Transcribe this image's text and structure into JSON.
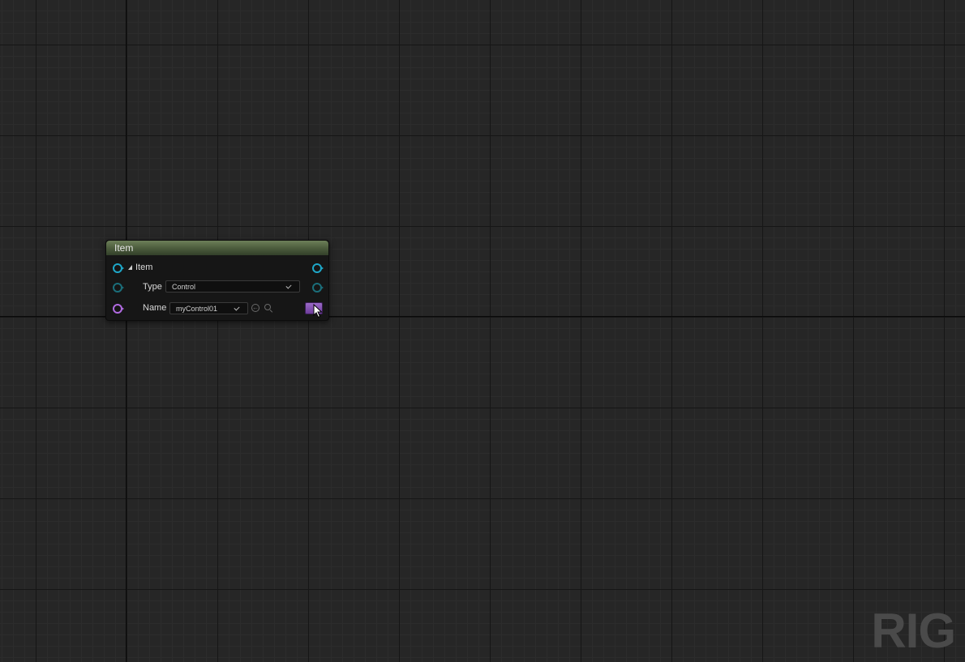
{
  "node": {
    "title": "Item",
    "rows": [
      {
        "label": "Item"
      },
      {
        "label": "Type",
        "value": "Control"
      },
      {
        "label": "Name",
        "value": "myControl01"
      }
    ]
  },
  "watermark": "RIG",
  "colors": {
    "header_green": "#5a6e48",
    "pin_cyan": "#1ea7c8",
    "pin_teal": "#1b6e7a",
    "pin_violet": "#b06ae0",
    "button_purple": "#8a55b8"
  },
  "icons": [
    "expand-triangle-icon",
    "chevron-down-icon",
    "reset-to-default-icon",
    "search-icon",
    "mouse-cursor-icon"
  ]
}
